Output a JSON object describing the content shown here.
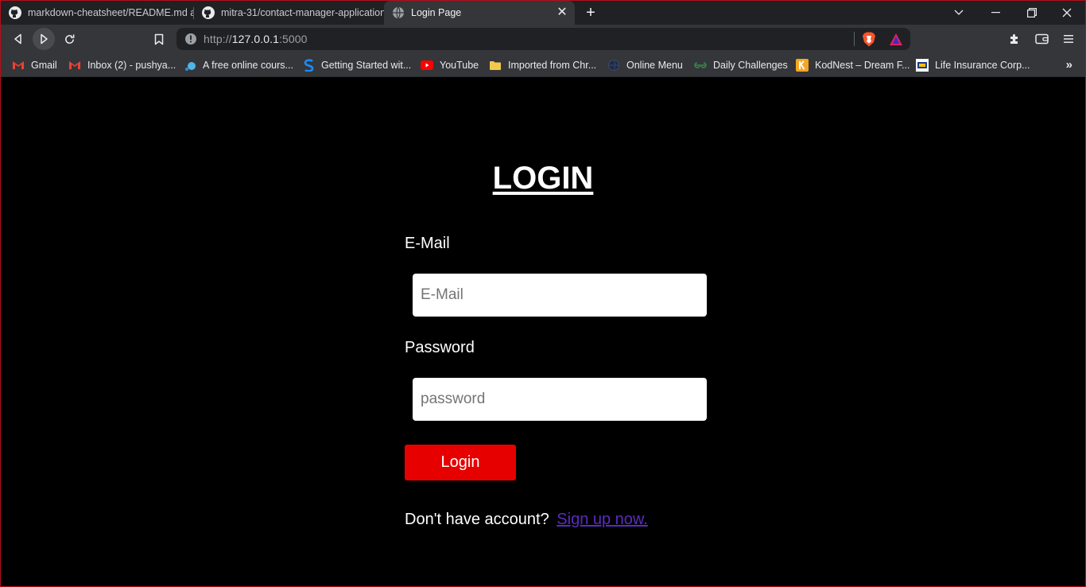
{
  "browser": {
    "tabs": [
      {
        "title": "markdown-cheatsheet/README.md at",
        "icon": "github-icon",
        "active": false
      },
      {
        "title": "mitra-31/contact-manager-application",
        "icon": "github-icon",
        "active": false
      },
      {
        "title": "Login Page",
        "icon": "globe-icon",
        "active": true
      }
    ],
    "new_tab_label": "+",
    "url_scheme": "http://",
    "url_host": "127.0.0.1",
    "url_port": ":5000",
    "bookmarks": [
      {
        "label": "Gmail",
        "icon": "gmail-icon"
      },
      {
        "label": "Inbox (2) - pushya...",
        "icon": "gmail-icon"
      },
      {
        "label": "A free online cours...",
        "icon": "dot-icon"
      },
      {
        "label": "Getting Started wit...",
        "icon": "s-logo-icon"
      },
      {
        "label": "YouTube",
        "icon": "youtube-icon"
      },
      {
        "label": "Imported from Chr...",
        "icon": "folder-icon"
      },
      {
        "label": "Online Menu",
        "icon": "globe-icon"
      },
      {
        "label": "Daily Challenges",
        "icon": "gfg-icon"
      },
      {
        "label": "KodNest – Dream F...",
        "icon": "k-logo-icon"
      },
      {
        "label": "Life Insurance Corp...",
        "icon": "lic-icon"
      }
    ],
    "bookmarks_more": "»"
  },
  "page": {
    "title": "LOGIN",
    "email_label": "E-Mail",
    "email_placeholder": "E-Mail",
    "email_value": "",
    "password_label": "Password",
    "password_placeholder": "password",
    "password_value": "",
    "login_button": "Login",
    "signup_prompt": "Don't have account?",
    "signup_link": "Sign up now."
  },
  "colors": {
    "background": "#000000",
    "button": "#e60000",
    "link": "#5a2bc0",
    "window_border": "#b3101a"
  }
}
